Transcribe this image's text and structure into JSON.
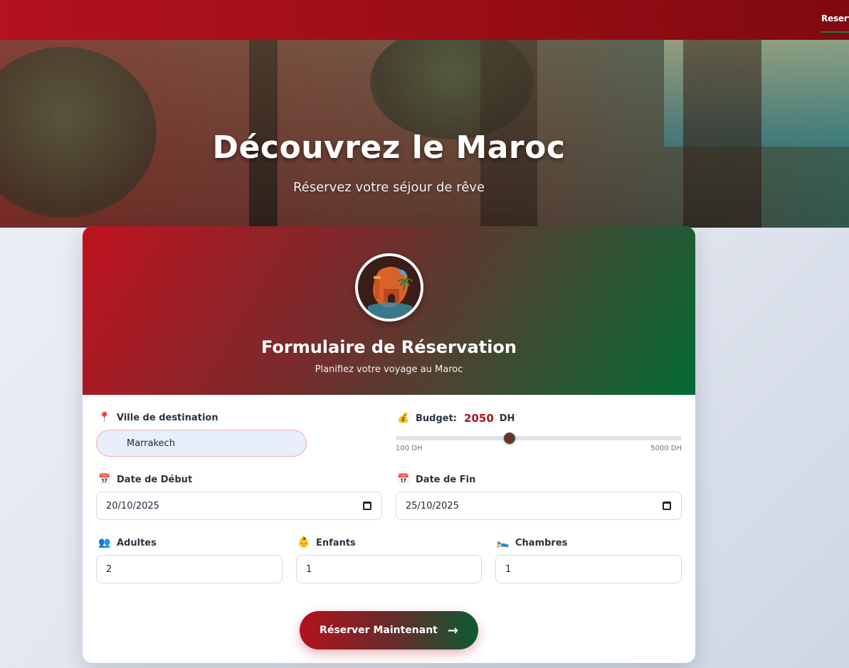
{
  "nav": {
    "link_label": "Reserv"
  },
  "hero": {
    "title": "Découvrez le Maroc",
    "subtitle": "Réservez votre séjour de rêve"
  },
  "card": {
    "title": "Formulaire de Réservation",
    "subtitle": "Planifiez votre voyage au Maroc"
  },
  "form": {
    "city": {
      "icon": "📍",
      "label": "Ville de destination",
      "value": "Marrakech"
    },
    "budget": {
      "icon": "💰",
      "label": "Budget:",
      "value": "2050",
      "unit": "DH",
      "min_label": "100 DH",
      "max_label": "5000 DH",
      "min": 100,
      "max": 5000,
      "current": 2050
    },
    "start_date": {
      "icon": "📅",
      "label": "Date de Début",
      "value": "20/10/2025"
    },
    "end_date": {
      "icon": "📅",
      "label": "Date de Fin",
      "value": "25/10/2025"
    },
    "adults": {
      "icon": "👥",
      "label": "Adultes",
      "value": "2"
    },
    "children": {
      "icon": "👶",
      "label": "Enfants",
      "value": "1"
    },
    "rooms": {
      "icon": "🛌",
      "label": "Chambres",
      "value": "1"
    },
    "submit_label": "Réserver Maintenant",
    "submit_arrow": "→"
  },
  "colors": {
    "primary_red": "#b3121e",
    "primary_green": "#046a35"
  }
}
